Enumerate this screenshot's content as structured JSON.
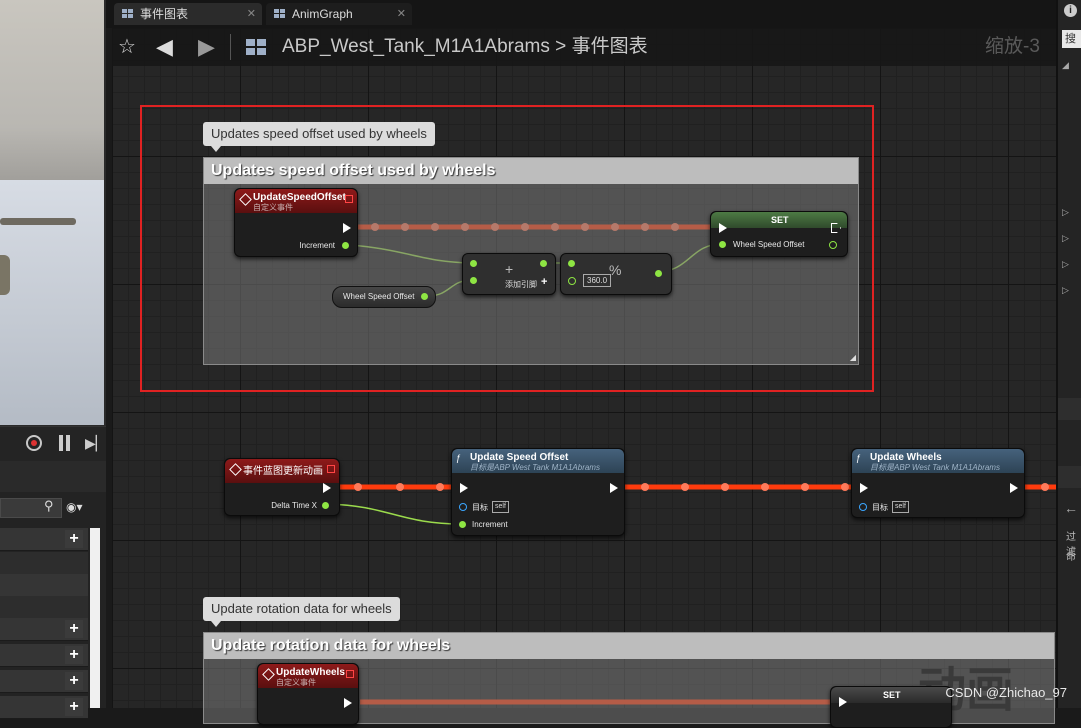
{
  "tabs": [
    {
      "label": "事件图表",
      "active": true
    },
    {
      "label": "AnimGraph",
      "active": false
    }
  ],
  "toolbar": {
    "breadcrumb_asset": "ABP_West_Tank_M1A1Abrams",
    "breadcrumb_sep": ">",
    "breadcrumb_graph": "事件图表",
    "zoom": "缩放-3"
  },
  "comments": {
    "speed": {
      "bubble": "Updates speed offset used by wheels",
      "header": "Updates speed offset used by wheels"
    },
    "rotation": {
      "bubble": "Update rotation data for wheels",
      "header": "Update rotation data for wheels"
    }
  },
  "nodes": {
    "update_speed_offset_event": {
      "title": "UpdateSpeedOffset",
      "subtitle": "自定义事件",
      "pin_increment": "Increment"
    },
    "wheel_speed_offset_get": {
      "label": "Wheel Speed Offset"
    },
    "add_node": {
      "symbol": "+",
      "label": "添加引脚",
      "add_icon": "+"
    },
    "mod_node": {
      "symbol": "%",
      "value": "360.0"
    },
    "set_node": {
      "title": "SET",
      "pin_var": "Wheel Speed Offset"
    },
    "blueprint_update_event": {
      "title": "事件蓝图更新动画",
      "pin_delta": "Delta Time X"
    },
    "update_speed_offset_call": {
      "title": "Update Speed Offset",
      "subtitle": "目标是ABP West Tank M1A1Abrams",
      "pin_target": "目标",
      "self": "self",
      "pin_increment": "Increment"
    },
    "update_wheels_call": {
      "title": "Update Wheels",
      "subtitle": "目标是ABP West Tank M1A1Abrams",
      "pin_target": "目标",
      "self": "self"
    },
    "update_wheels_event": {
      "title": "UpdateWheels",
      "subtitle": "自定义事件"
    },
    "set_node_2": {
      "title": "SET"
    }
  },
  "right_panel": {
    "search_label": "搜",
    "items": [
      "过滤",
      "命"
    ]
  },
  "watermark": "CSDN @Zhichao_97",
  "background_text": "动画",
  "colors": {
    "exec_wire": "#ff3b0d",
    "float_wire": "#9bdb4c",
    "highlight": "#e02222"
  }
}
